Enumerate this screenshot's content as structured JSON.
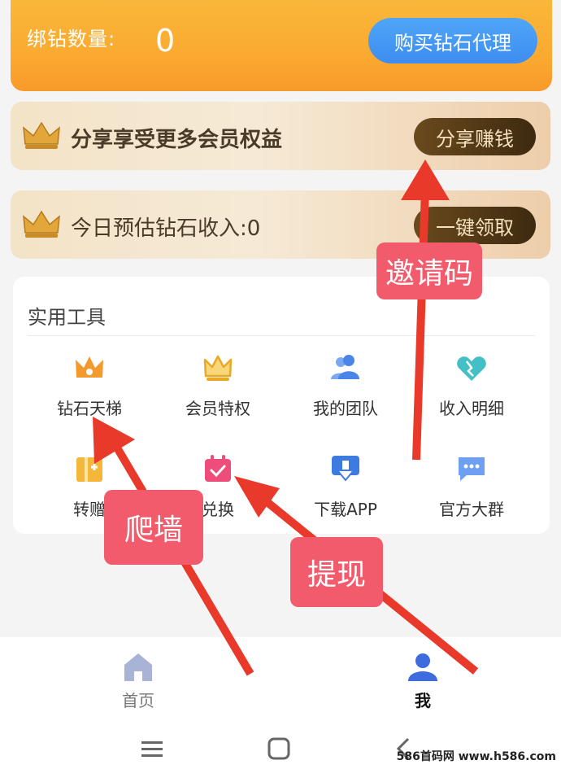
{
  "top": {
    "bind_label": "绑钻数量:",
    "bind_count": "0",
    "buy_button": "购买钻石代理"
  },
  "share_card": {
    "text": "分享享受更多会员权益",
    "button": "分享赚钱"
  },
  "income_card": {
    "text": "今日预估钻石收入:0",
    "button": "一键领取"
  },
  "tools": {
    "title": "实用工具",
    "items": [
      {
        "label": "钻石天梯",
        "icon": "crown-orange-icon"
      },
      {
        "label": "会员特权",
        "icon": "crown-outline-icon"
      },
      {
        "label": "我的团队",
        "icon": "team-icon"
      },
      {
        "label": "收入明细",
        "icon": "heart-icon"
      },
      {
        "label": "转赠",
        "icon": "gift-ticket-icon"
      },
      {
        "label": "兑换",
        "icon": "calendar-check-icon"
      },
      {
        "label": "下载APP",
        "icon": "download-icon"
      },
      {
        "label": "官方大群",
        "icon": "chat-icon"
      }
    ]
  },
  "nav": {
    "home": "首页",
    "me": "我"
  },
  "annotations": {
    "invite": "邀请码",
    "climb": "爬墙",
    "withdraw": "提现"
  },
  "watermark": "586首码网 www.h586.com",
  "colors": {
    "orange": "#fbaa31",
    "blue_button": "#3d8df0",
    "gold_button": "#4a3214",
    "annotation": "#f25b6b",
    "arrow": "#e8392a"
  }
}
